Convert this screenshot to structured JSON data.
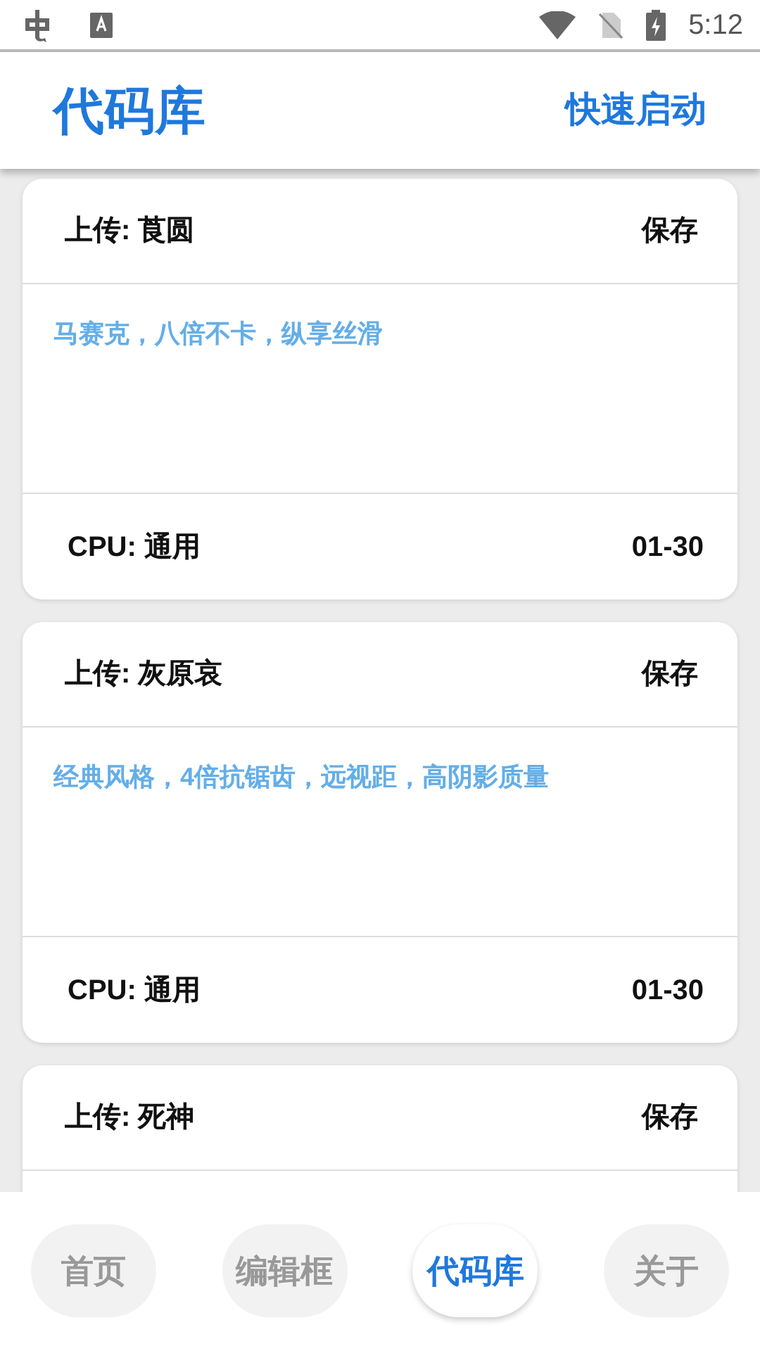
{
  "status_bar": {
    "time": "5:12"
  },
  "app_bar": {
    "title": "代码库",
    "action": "快速启动"
  },
  "cards": [
    {
      "uploader": "上传: 莨圆",
      "save": "保存",
      "description": "马赛克，八倍不卡，纵享丝滑",
      "cpu": "CPU: 通用",
      "date": "01-30"
    },
    {
      "uploader": "上传: 灰原哀",
      "save": "保存",
      "description": "经典风格，4倍抗锯齿，远视距，高阴影质量",
      "cpu": "CPU: 通用",
      "date": "01-30"
    },
    {
      "uploader": "上传: 死神",
      "save": "保存"
    }
  ],
  "bottom_nav": [
    {
      "label": "首页",
      "selected": false
    },
    {
      "label": "编辑框",
      "selected": false
    },
    {
      "label": "代码库",
      "selected": true
    },
    {
      "label": "关于",
      "selected": false
    }
  ]
}
